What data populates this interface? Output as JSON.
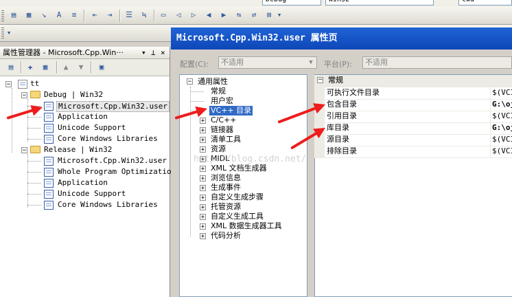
{
  "toolbar": {
    "config_combo": "Debug",
    "platform_combo": "Win32",
    "find_combo": "cwd"
  },
  "property_manager": {
    "title": "属性管理器 - Microsoft.Cpp.Win···",
    "pin_icon": "⊥",
    "close_icon": "×",
    "tree": {
      "project": "tt",
      "debug": "Debug | Win32",
      "debug_items": [
        "Microsoft.Cpp.Win32.user",
        "Application",
        "Unicode Support",
        "Core Windows Libraries"
      ],
      "release": "Release | Win32",
      "release_items": [
        "Microsoft.Cpp.Win32.user",
        "Whole Program Optimization",
        "Application",
        "Unicode Support",
        "Core Windows Libraries"
      ]
    }
  },
  "dialog": {
    "title": "Microsoft.Cpp.Win32.user 属性页",
    "config_label": "配置(C):",
    "config_value": "不适用",
    "platform_label": "平台(P):",
    "platform_value": "不适用",
    "tree": {
      "root": "通用属性",
      "items": [
        "常规",
        "用户宏",
        "VC++ 目录"
      ],
      "expandable": [
        "C/C++",
        "链接器",
        "清单工具",
        "资源",
        "MIDL",
        "XML 文档生成器",
        "浏览信息",
        "生成事件",
        "自定义生成步骤",
        "托管资源",
        "自定义生成工具",
        "XML 数据生成器工具",
        "代码分析"
      ]
    },
    "grid": {
      "category": "常规",
      "rows": [
        {
          "name": "可执行文件目录",
          "value": "$(VCI"
        },
        {
          "name": "包含目录",
          "value": "G:\\oj"
        },
        {
          "name": "引用目录",
          "value": "$(VCI"
        },
        {
          "name": "库目录",
          "value": "G:\\oj"
        },
        {
          "name": "源目录",
          "value": "$(VCI"
        },
        {
          "name": "排除目录",
          "value": "$(VCI"
        }
      ]
    }
  },
  "watermark": "http://blog.csdn.net/",
  "colors": {
    "arrow": "#ee1c1c",
    "title_bar": "#1f63d6",
    "selection": "#316ac5"
  }
}
